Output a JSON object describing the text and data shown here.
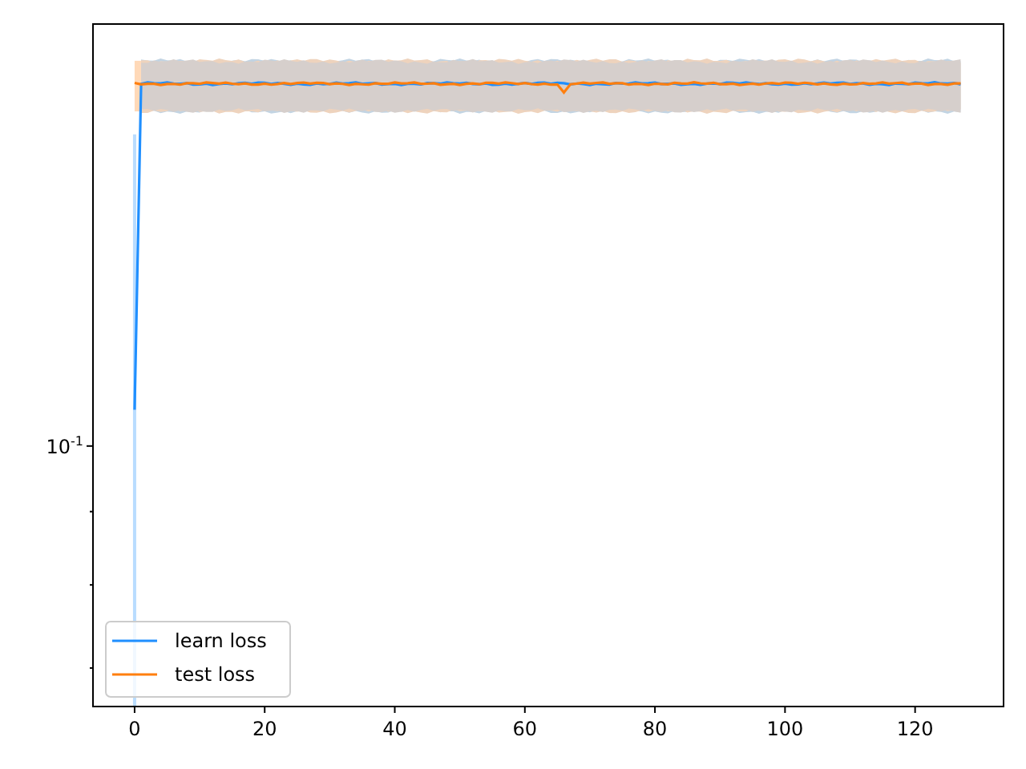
{
  "plot": {
    "x_ticks": [
      "0",
      "20",
      "40",
      "60",
      "80",
      "100",
      "120"
    ],
    "y_ticks": [
      "10$^{-1}$"
    ],
    "legend": [
      {
        "label": "learn loss",
        "color": "#1f8fff"
      },
      {
        "label": "test loss",
        "color": "#ff7f0e"
      }
    ]
  }
}
